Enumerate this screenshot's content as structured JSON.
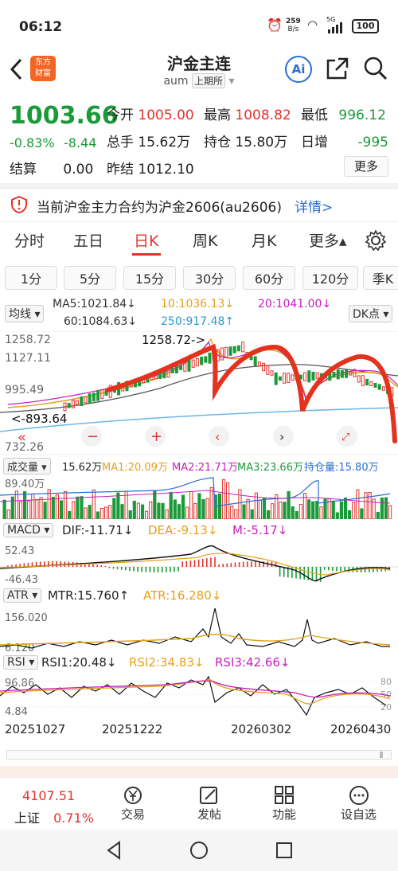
{
  "status_bar": {
    "time": "06:12",
    "speed_top": "259",
    "speed_unit": "B/s",
    "signal": "5G",
    "battery": "100"
  },
  "header": {
    "logo_line1": "东方",
    "logo_line2": "财富",
    "title": "沪金主连",
    "subtitle": "aum",
    "exchange": "上期所",
    "ai": "Ai"
  },
  "quote": {
    "price": "1003.66",
    "change_pct": "-0.83%",
    "change": "-8.44",
    "open_label": "今开",
    "open": "1005.00",
    "high_label": "最高",
    "high": "1008.82",
    "low_label": "最低",
    "low": "996.12",
    "volume_label": "总手",
    "volume": "15.62万",
    "oi_label": "持仓",
    "oi": "15.80万",
    "oi_change_label": "日增",
    "oi_change": "-995",
    "settle_label": "结算",
    "settle": "0.00",
    "prev_close_label": "昨结",
    "prev_close": "1012.10",
    "more": "更多"
  },
  "notice": {
    "text": "当前沪金主力合约为沪金2606(au2606)",
    "link": "详情>"
  },
  "tabs": [
    "分时",
    "五日",
    "日K",
    "周K",
    "月K",
    "更多▴"
  ],
  "active_tab": "日K",
  "intervals": [
    "1分",
    "5分",
    "15分",
    "30分",
    "60分",
    "120分",
    "季K"
  ],
  "kline": {
    "indicator": "均线",
    "ma5": "MA5:1021.84↓",
    "ma10": "10:1036.13↓",
    "ma20": "20:1041.00↓",
    "ma60": "60:1084.63↓",
    "ma250": "250:917.48↑",
    "dk": "DK点",
    "y_labels": [
      "1258.72",
      "1127.11",
      "995.49",
      "893.64",
      "732.26"
    ],
    "max_label": "1258.72->",
    "min_label": "<-893.64"
  },
  "volume": {
    "title": "成交量",
    "val": "15.62万",
    "ma1": "MA1:20.09万",
    "ma2": "MA2:21.71万",
    "ma3": "MA3:23.66万",
    "oi": "持仓量:15.80万",
    "y_top": "89.40万"
  },
  "macd": {
    "title": "MACD",
    "dif": "DIF:-11.71↓",
    "dea": "DEA:-9.13↓",
    "m": "M:-5.17↓",
    "y_top": "52.43",
    "y_bot": "-46.43"
  },
  "atr": {
    "title": "ATR",
    "mtr": "MTR:15.760↑",
    "atr": "ATR:16.280↓",
    "y_top": "156.020",
    "y_bot": "6.120"
  },
  "rsi": {
    "title": "RSI",
    "rsi1": "RSI1:20.48↓",
    "rsi2": "RSI2:34.83↓",
    "rsi3": "RSI3:42.66↓",
    "y_top": "96.86",
    "y_bot": "4.84",
    "r80": "80",
    "r50": "50",
    "r20": "20"
  },
  "x_dates": [
    "20251027",
    "20251222",
    "20260302",
    "20260430"
  ],
  "bottom": {
    "index_name": "上证",
    "index_val": "4107.51",
    "index_pct": "0.71%",
    "trade": "交易",
    "post": "发帖",
    "func": "功能",
    "watch": "设自选"
  },
  "colors": {
    "up": "#e4332d",
    "down": "#1b9a3a",
    "accent": "#e4332d",
    "link": "#2a6ed1"
  }
}
